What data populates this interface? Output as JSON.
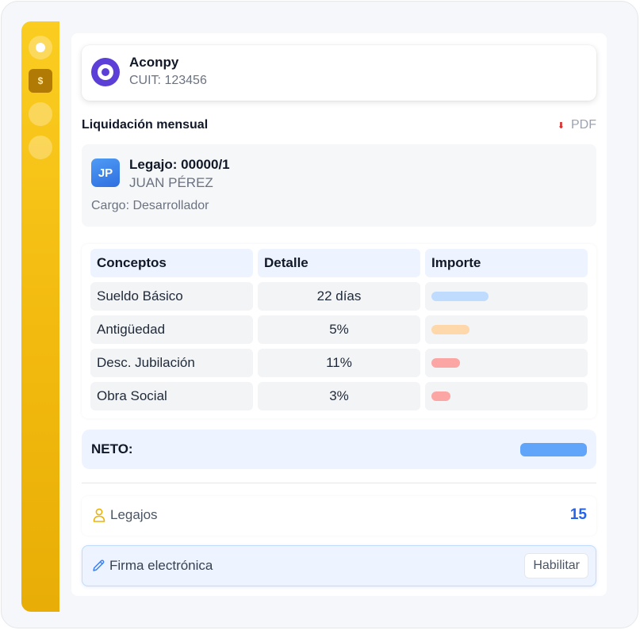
{
  "sidebar": {
    "items": [
      {
        "name": "home-dot"
      },
      {
        "name": "dollar-square",
        "glyph": "$"
      },
      {
        "name": "nav-dot-3"
      },
      {
        "name": "nav-dot-4"
      }
    ],
    "accent": "#f2b90e"
  },
  "company": {
    "name": "Aconpy",
    "cuit": "CUIT: 123456",
    "logo_color": "#5b3fd6"
  },
  "payslip": {
    "section_title": "Liquidación mensual",
    "pdf_label": "PDF",
    "pdf_icon": "download-arrow-icon"
  },
  "employee": {
    "initials": "JP",
    "legajo": "Legajo: 00000/1",
    "name": "JUAN PÉREZ",
    "cargo": "Cargo: Desarrollador"
  },
  "table": {
    "headers": [
      "Conceptos",
      "Detalle",
      "Importe"
    ],
    "rows": [
      {
        "concepto": "Sueldo Básico",
        "detalle": "22 días",
        "importe_bar_color": "#bfdbfe",
        "importe_relative": 1.0
      },
      {
        "concepto": "Antigüedad",
        "detalle": "5%",
        "importe_bar_color": "#fed7aa",
        "importe_relative": 0.67
      },
      {
        "concepto": "Desc. Jubilación",
        "detalle": "11%",
        "importe_bar_color": "#fca5a5",
        "importe_relative": 0.5
      },
      {
        "concepto": "Obra Social",
        "detalle": "3%",
        "importe_bar_color": "#fca5a5",
        "importe_relative": 0.33
      }
    ]
  },
  "neto": {
    "label": "NETO:",
    "bar_color": "#60a5fa"
  },
  "legajos": {
    "label": "Legajos",
    "count": "15",
    "icon": "user-icon"
  },
  "firma": {
    "label": "Firma electrónica",
    "button": "Habilitar",
    "icon": "pencil-icon"
  }
}
